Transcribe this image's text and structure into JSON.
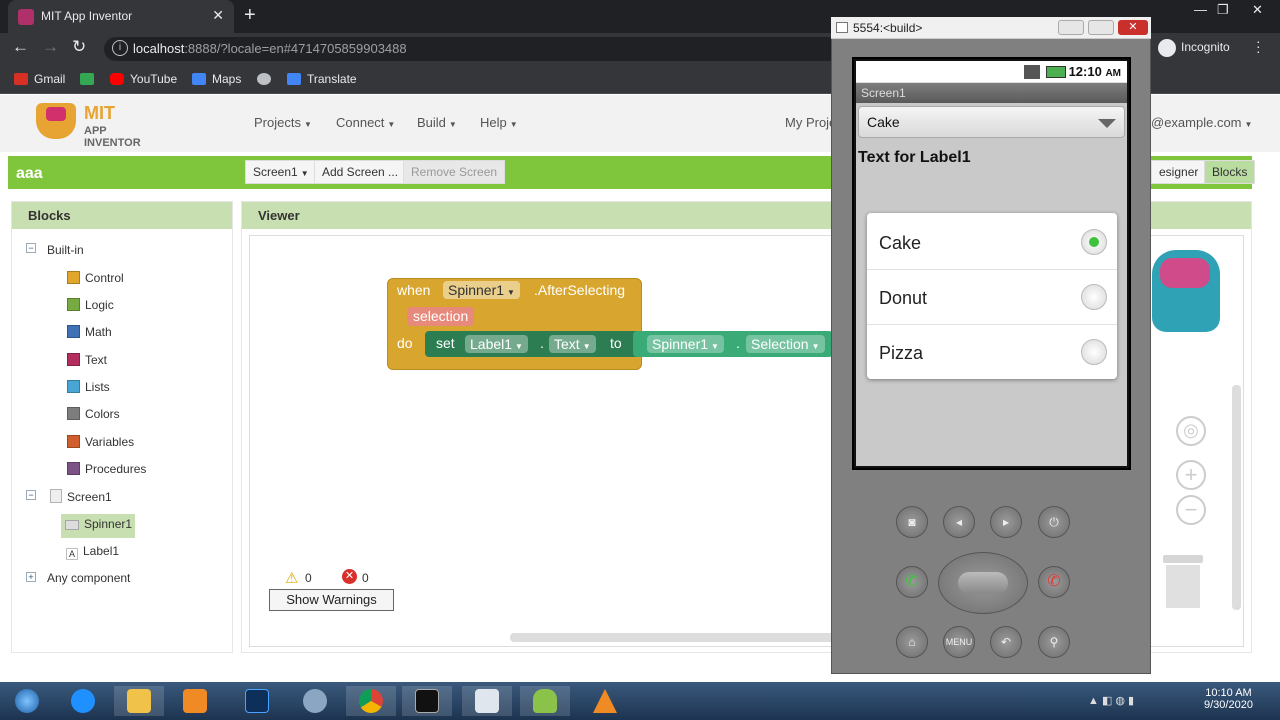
{
  "browser": {
    "tab_title": "MIT App Inventor",
    "url_host": "localhost",
    "url_rest": ":8888/?locale=en#4714705859903488",
    "profile": "Incognito",
    "bookmarks": [
      "Gmail",
      "YouTube",
      "Maps",
      "Translate"
    ]
  },
  "app": {
    "logo_title": "MIT",
    "logo_subtitle": "APP INVENTOR",
    "menu": [
      "Projects",
      "Connect",
      "Build",
      "Help"
    ],
    "my_projects": "My Proje",
    "account": "@example.com",
    "project_name": "aaa",
    "screen_select": "Screen1",
    "add_screen": "Add Screen ...",
    "remove_screen": "Remove Screen",
    "designer_btn": "esigner",
    "blocks_btn": "Blocks"
  },
  "blocks_panel": {
    "title": "Blocks",
    "builtin": "Built-in",
    "categories": [
      {
        "label": "Control",
        "color": "#e1a72c"
      },
      {
        "label": "Logic",
        "color": "#77ab41"
      },
      {
        "label": "Math",
        "color": "#3f71b5"
      },
      {
        "label": "Text",
        "color": "#b32d5e"
      },
      {
        "label": "Lists",
        "color": "#49a6d4"
      },
      {
        "label": "Colors",
        "color": "#7d7d7d"
      },
      {
        "label": "Variables",
        "color": "#d05f2d"
      },
      {
        "label": "Procedures",
        "color": "#7c5385"
      }
    ],
    "screen": "Screen1",
    "components": [
      "Spinner1",
      "Label1"
    ],
    "any_component": "Any component"
  },
  "viewer": {
    "title": "Viewer",
    "event_when": "when",
    "event_component": "Spinner1",
    "event_name": ".AfterSelecting",
    "param": "selection",
    "do": "do",
    "set": "set",
    "set_component": "Label1",
    "dot": ".",
    "set_property": "Text",
    "to": "to",
    "get_component": "Spinner1",
    "get_property": "Selection",
    "warnings_count": "0",
    "errors_count": "0",
    "show_warnings": "Show Warnings"
  },
  "emulator": {
    "window_title": "5554:<build>",
    "time": "12:10",
    "ampm": "AM",
    "screen_title": "Screen1",
    "spinner_value": "Cake",
    "label_text": "Text for Label1",
    "options": [
      {
        "label": "Cake",
        "selected": true
      },
      {
        "label": "Donut",
        "selected": false
      },
      {
        "label": "Pizza",
        "selected": false
      }
    ],
    "menu_btn": "MENU"
  },
  "taskbar": {
    "time": "10:10 AM",
    "date": "9/30/2020"
  }
}
